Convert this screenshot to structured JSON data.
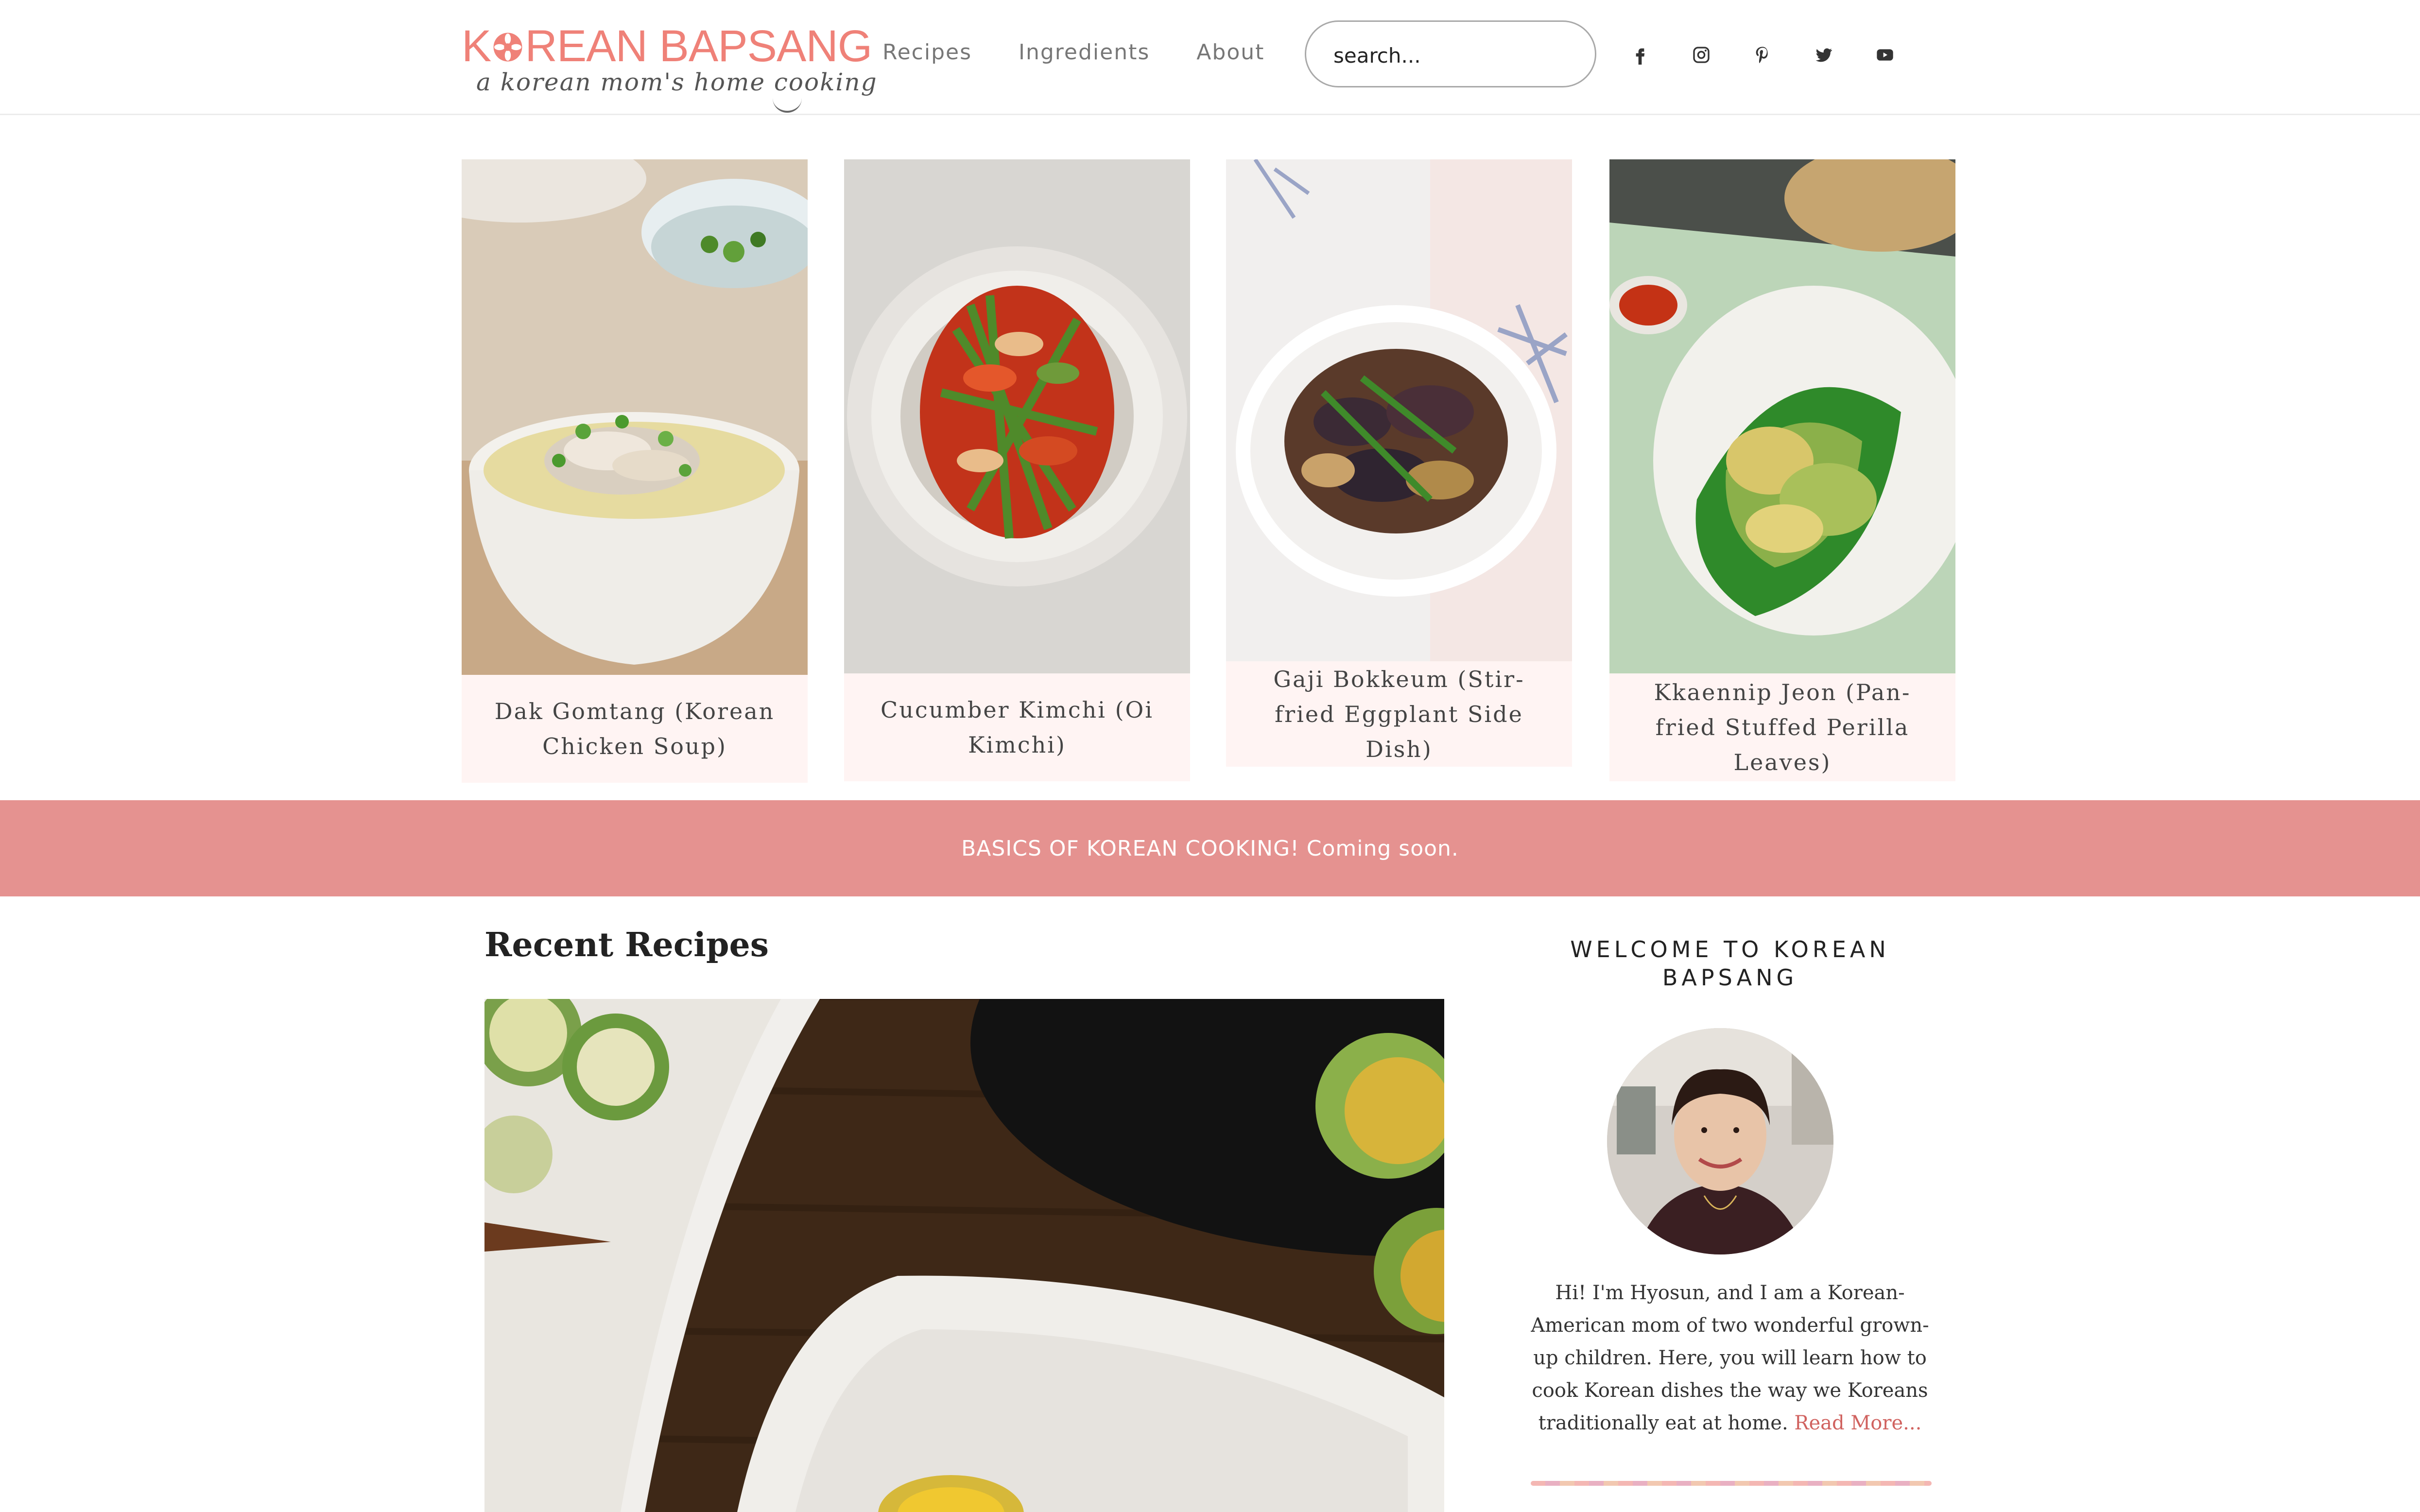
{
  "header": {
    "logo_title": "KOREAN BAPSANG",
    "logo_tagline": "a korean mom's home cooking",
    "nav": [
      "Recipes",
      "Ingredients",
      "About"
    ],
    "search_placeholder": "search...",
    "social_icons": [
      "facebook-icon",
      "instagram-icon",
      "pinterest-icon",
      "twitter-icon",
      "youtube-icon"
    ]
  },
  "featured": [
    {
      "title": "Dak Gomtang (Korean Chicken Soup)"
    },
    {
      "title": "Cucumber Kimchi (Oi Kimchi)"
    },
    {
      "title": "Gaji Bokkeum (Stir-fried Eggplant Side Dish)"
    },
    {
      "title": "Kkaennip Jeon (Pan-fried Stuffed Perilla Leaves)"
    }
  ],
  "banner": {
    "text": "BASICS OF KOREAN COOKING! Coming soon."
  },
  "main": {
    "recent_title": "Recent Recipes"
  },
  "sidebar": {
    "welcome_title": "WELCOME TO KOREAN BAPSANG",
    "bio": "Hi! I'm Hyosun, and I am a Korean-American mom of two wonderful grown-up children. Here, you will learn how to cook Korean dishes the way we Koreans traditionally eat at home.",
    "read_more": "Read More..."
  },
  "colors": {
    "brand": "#ef8178",
    "banner": "#e59290",
    "caption_bg": "#fff4f3",
    "link": "#d0625f"
  }
}
